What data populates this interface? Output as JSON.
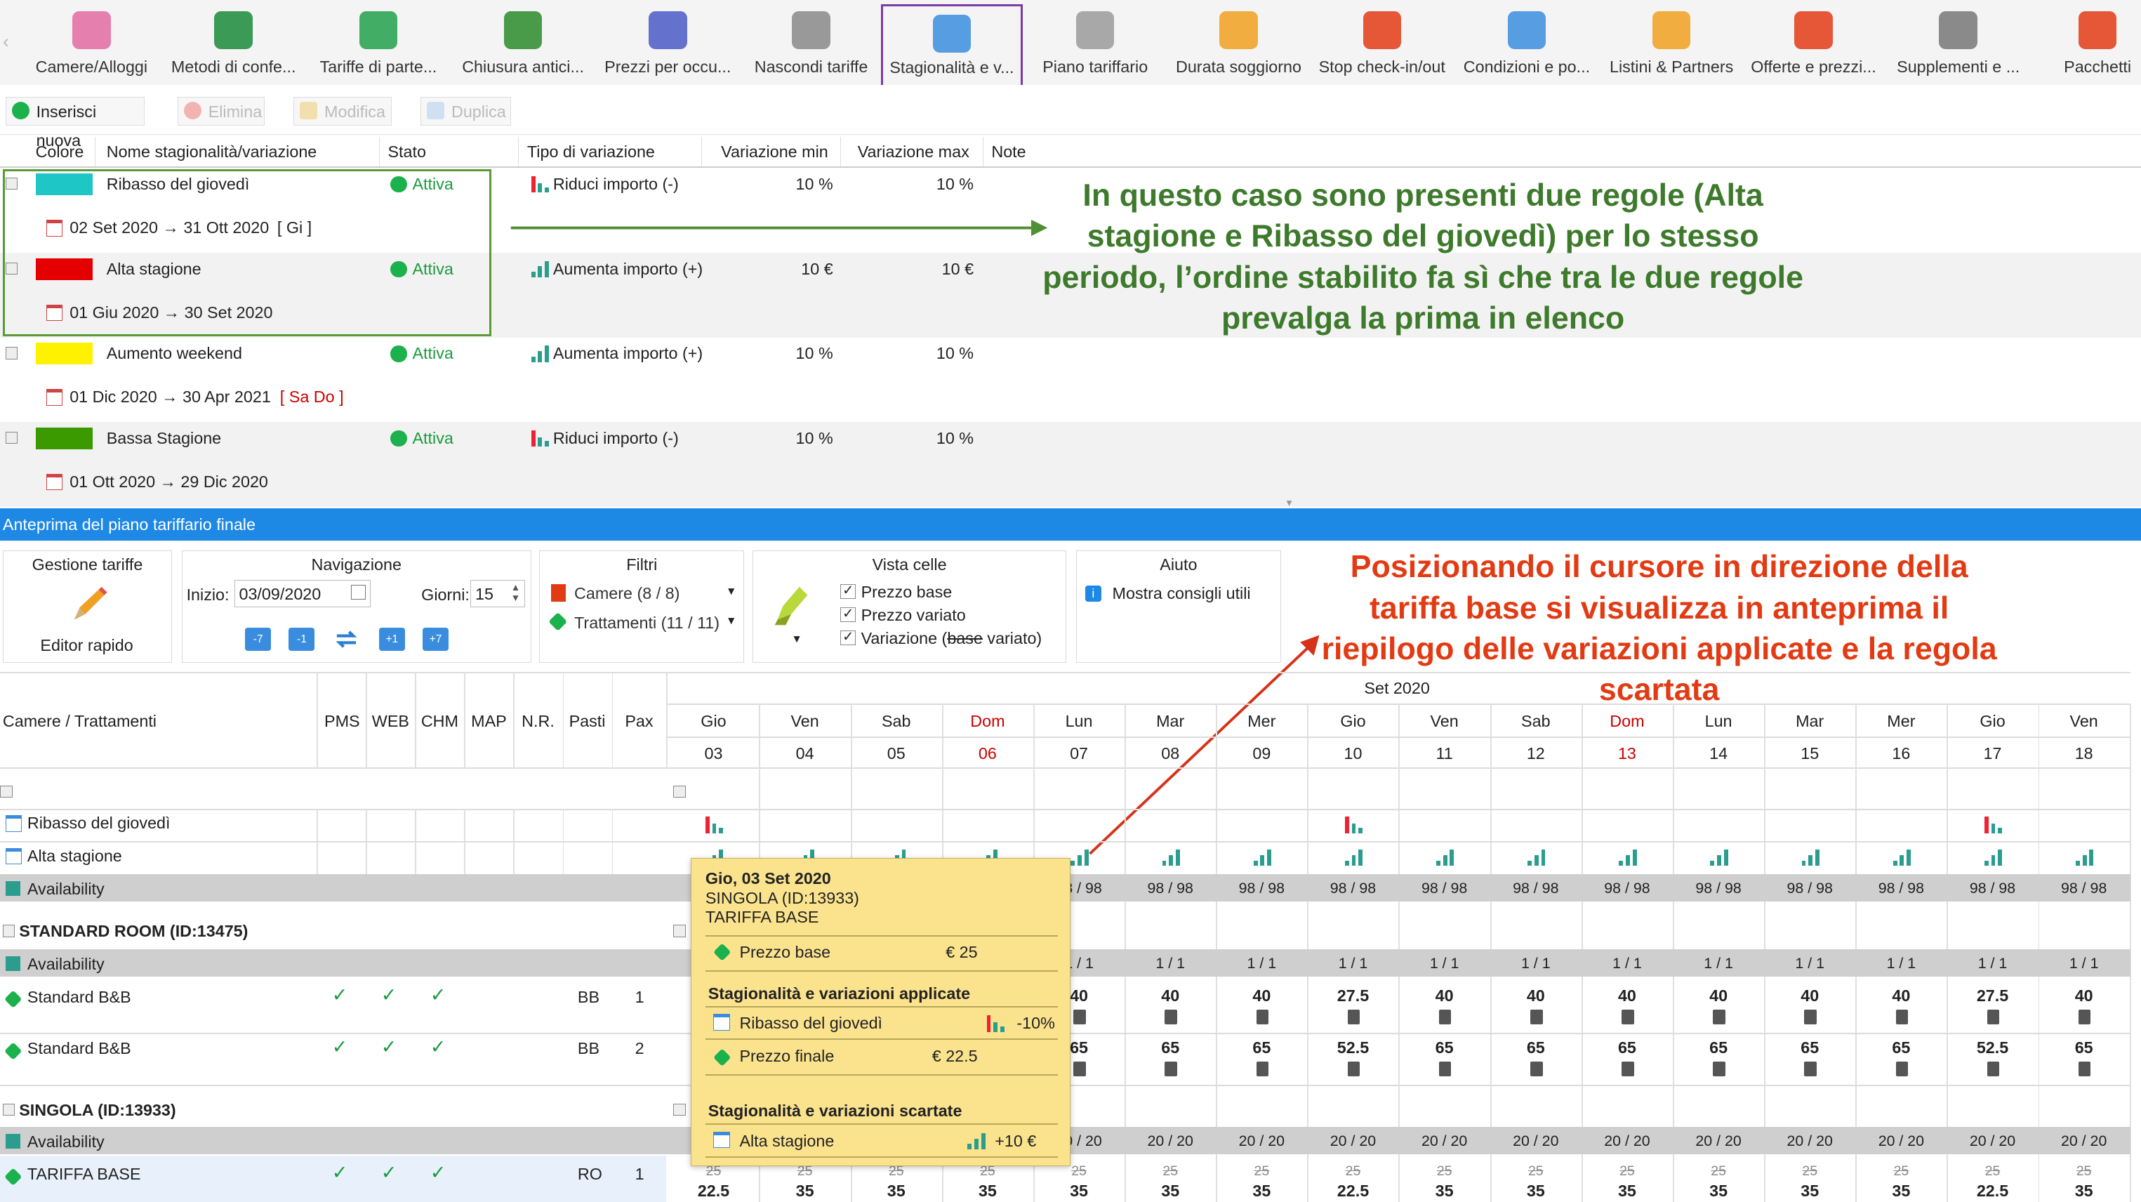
{
  "toolbar": {
    "items": [
      {
        "label": "Camere/Alloggi",
        "icon": "bed-icon"
      },
      {
        "label": "Metodi di confe...",
        "icon": "money-icon"
      },
      {
        "label": "Tariffe di parte...",
        "icon": "tag-icon"
      },
      {
        "label": "Chiusura antici...",
        "icon": "timer-lock-icon"
      },
      {
        "label": "Prezzi per occu...",
        "icon": "chart-icon"
      },
      {
        "label": "Nascondi tariffe",
        "icon": "eye-off-calendar-icon"
      },
      {
        "label": "Stagionalità e v...",
        "icon": "calendar-arrows-icon"
      },
      {
        "label": "Piano tariffario",
        "icon": "grid-calendar-icon"
      },
      {
        "label": "Durata soggiorno",
        "icon": "ruler-icon"
      },
      {
        "label": "Stop check-in/out",
        "icon": "stop-calendar-icon"
      },
      {
        "label": "Condizioni e po...",
        "icon": "document-icon"
      },
      {
        "label": "Listini & Partners",
        "icon": "handshake-icon"
      },
      {
        "label": "Offerte e prezzi...",
        "icon": "discount-icon"
      },
      {
        "label": "Supplementi e ...",
        "icon": "bell-plus-icon"
      },
      {
        "label": "Pacchetti",
        "icon": "gift-icon"
      }
    ]
  },
  "actions": {
    "insert": "Inserisci nuova",
    "delete": "Elimina",
    "edit": "Modifica",
    "duplicate": "Duplica"
  },
  "rules_table": {
    "headers": [
      "Colore",
      "Nome stagionalità/variazione",
      "Stato",
      "Tipo di variazione",
      "Variazione min",
      "Variazione max",
      "Note"
    ],
    "rows": [
      {
        "color": "#1ec6c6",
        "name": "Ribasso del giovedì",
        "status": "Attiva",
        "type": "Riduci importo (-)",
        "min": "10 %",
        "max": "10 %",
        "dates": "02 Set 2020 → 31 Ott 2020",
        "days": "[ Gi ]"
      },
      {
        "color": "#e50000",
        "name": "Alta stagione",
        "status": "Attiva",
        "type": "Aumenta importo (+)",
        "min": "10 €",
        "max": "10 €",
        "dates": "01 Giu 2020 → 30 Set 2020",
        "days": ""
      },
      {
        "color": "#fff200",
        "name": "Aumento weekend",
        "status": "Attiva",
        "type": "Aumenta importo (+)",
        "min": "10 %",
        "max": "10 %",
        "dates": "01 Dic 2020 → 30 Apr 2021",
        "days": "[ Sa Do ]"
      },
      {
        "color": "#3a9a00",
        "name": "Bassa Stagione",
        "status": "Attiva",
        "type": "Riduci importo (-)",
        "min": "10 %",
        "max": "10 %",
        "dates": "01 Ott 2020 → 29 Dic 2020",
        "days": ""
      }
    ]
  },
  "annotations": {
    "first": "In questo caso sono presenti due regole (Alta stagione e Ribasso del giovedì) per lo stesso periodo, l’ordine stabilito fa sì che tra le due regole prevalga la prima in elenco",
    "second": "Posizionando il cursore in direzione della tariffa base si visualizza in anteprima il riepilogo delle variazioni applicate e la regola scartata"
  },
  "preview": {
    "title": "Anteprima del piano tariffario finale",
    "gestione": {
      "title": "Gestione tariffe",
      "button": "Editor rapido"
    },
    "navigazione": {
      "title": "Navigazione",
      "start_label": "Inizio:",
      "start_value": "03/09/2020",
      "days_label": "Giorni:",
      "days_value": "15",
      "buttons": [
        "-7",
        "-1",
        "",
        "+1",
        "+7"
      ]
    },
    "filtri": {
      "title": "Filtri",
      "camere": "Camere (8 / 8)",
      "trattamenti": "Trattamenti (11 / 11)"
    },
    "vista": {
      "title": "Vista celle",
      "options": [
        "Prezzo base",
        "Prezzo variato"
      ],
      "variazione_prefix": "Variazione (",
      "variazione_base": "base",
      "variazione_suffix": " variato)"
    },
    "aiuto": {
      "title": "Aiuto",
      "text": "Mostra consigli utili"
    }
  },
  "grid": {
    "month": "Set 2020",
    "headers": [
      "Camere / Trattamenti",
      "PMS",
      "WEB",
      "CHM",
      "MAP",
      "N.R.",
      "Pasti",
      "Pax"
    ],
    "days": [
      {
        "dow": "Gio",
        "num": "03"
      },
      {
        "dow": "Ven",
        "num": "04"
      },
      {
        "dow": "Sab",
        "num": "05"
      },
      {
        "dow": "Dom",
        "num": "06"
      },
      {
        "dow": "Lun",
        "num": "07"
      },
      {
        "dow": "Mar",
        "num": "08"
      },
      {
        "dow": "Mer",
        "num": "09"
      },
      {
        "dow": "Gio",
        "num": "10"
      },
      {
        "dow": "Ven",
        "num": "11"
      },
      {
        "dow": "Sab",
        "num": "12"
      },
      {
        "dow": "Dom",
        "num": "13"
      },
      {
        "dow": "Lun",
        "num": "14"
      },
      {
        "dow": "Mar",
        "num": "15"
      },
      {
        "dow": "Mer",
        "num": "16"
      },
      {
        "dow": "Gio",
        "num": "17"
      },
      {
        "dow": "Ven",
        "num": "18"
      }
    ],
    "rows": {
      "ribasso": "Ribasso del giovedì",
      "alta": "Alta stagione",
      "availability": "Availability",
      "standard_room": "STANDARD ROOM (ID:13475)",
      "standard_bb1": "Standard B&B",
      "standard_bb2": "Standard B&B",
      "singola": "SINGOLA (ID:13933)",
      "tariffa_base": "TARIFFA BASE"
    },
    "meals_bb": "BB",
    "meals_ro": "RO",
    "pax": [
      "1",
      "2",
      "1"
    ],
    "availability_top": "98 / 98",
    "availability_std": "1 / 1",
    "availability_sgl": "20 / 20",
    "price_bb1": [
      "40",
      "40",
      "40",
      "27.5",
      "40",
      "40",
      "40",
      "40",
      "40",
      "40",
      "27.5",
      "40"
    ],
    "price_bb2": [
      "65",
      "65",
      "65",
      "52.5",
      "65",
      "65",
      "65",
      "65",
      "65",
      "65",
      "52.5",
      "65"
    ],
    "base_strike": "25",
    "price_tariffa": [
      "22.5",
      "35",
      "35",
      "35",
      "35",
      "35",
      "35",
      "22.5",
      "35",
      "35",
      "35",
      "35",
      "35",
      "35",
      "22.5",
      "35"
    ]
  },
  "tooltip": {
    "date": "Gio, 03 Set 2020",
    "room": "SINGOLA (ID:13933)",
    "rate": "TARIFFA BASE",
    "base_label": "Prezzo base",
    "base_value": "€ 25",
    "applied_title": "Stagionalità e variazioni applicate",
    "applied_name": "Ribasso del giovedì",
    "applied_value": "-10%",
    "final_label": "Prezzo finale",
    "final_value": "€ 22.5",
    "discarded_title": "Stagionalità e variazioni scartate",
    "discarded_name": "Alta stagione",
    "discarded_value": "+10 €"
  },
  "colors": {
    "accent_blue": "#1e88e5",
    "active_green": "#1bb14c",
    "annotation_green": "#3d7a2b",
    "annotation_red": "#e23b14",
    "tooltip_bg": "#fbe38e",
    "active_tab_border": "#7a3aa8"
  }
}
